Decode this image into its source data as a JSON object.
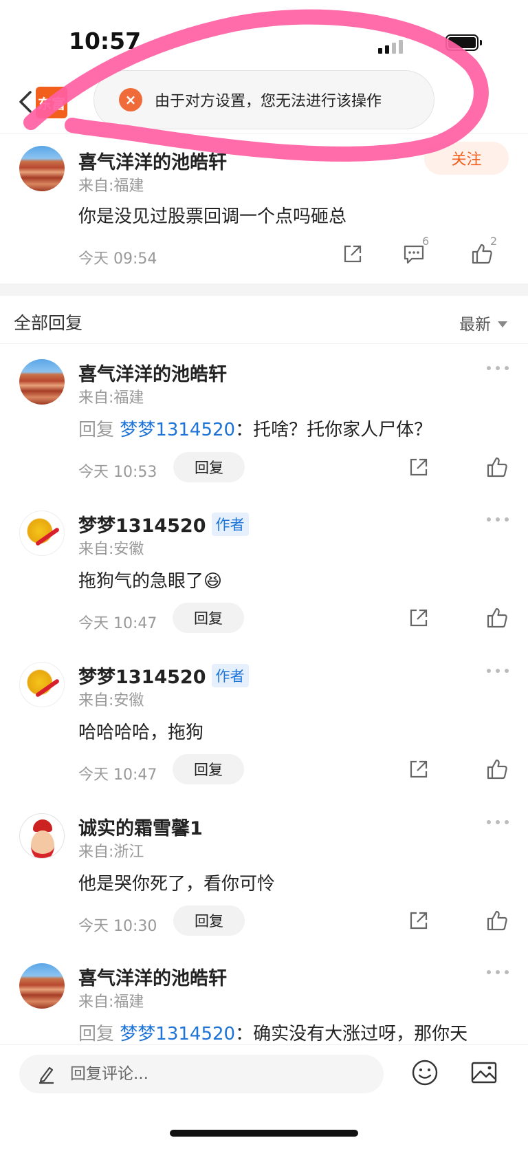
{
  "status_bar": {
    "time": "10:57"
  },
  "nav": {
    "app_logo_text": "东富"
  },
  "toast": {
    "icon": "close-icon",
    "text": "由于对方设置，您无法进行该操作"
  },
  "post": {
    "name": "喜气洋洋的池皓轩",
    "from": "来自:福建",
    "follow_label": "关注",
    "content": "你是没见过股票回调一个点吗砸总",
    "time": "今天 09:54",
    "comment_count": "6",
    "like_count": "2"
  },
  "section": {
    "title": "全部回复",
    "sort_label": "最新"
  },
  "replies": [
    {
      "name": "喜气洋洋的池皓轩",
      "badge": "",
      "from": "来自:福建",
      "prefix": "回复",
      "target": "梦梦1314520",
      "separator": "：",
      "text": "托啥？托你家人尸体？",
      "time": "今天 10:53",
      "reply_label": "回复"
    },
    {
      "name": "梦梦1314520",
      "badge": "作者",
      "from": "来自:安徽",
      "prefix": "",
      "target": "",
      "separator": "",
      "text": "拖狗气的急眼了😆",
      "time": "今天 10:47",
      "reply_label": "回复"
    },
    {
      "name": "梦梦1314520",
      "badge": "作者",
      "from": "来自:安徽",
      "prefix": "",
      "target": "",
      "separator": "",
      "text": "哈哈哈哈，拖狗",
      "time": "今天 10:47",
      "reply_label": "回复"
    },
    {
      "name": "诚实的霜雪馨1",
      "badge": "",
      "from": "来自:浙江",
      "prefix": "",
      "target": "",
      "separator": "",
      "text": "他是哭你死了，看你可怜",
      "time": "今天 10:30",
      "reply_label": "回复"
    },
    {
      "name": "喜气洋洋的池皓轩",
      "badge": "",
      "from": "来自:福建",
      "prefix": "回复",
      "target": "梦梦1314520",
      "separator": "：",
      "text": "确实没有大涨过呀，那你天",
      "time": "",
      "reply_label": ""
    }
  ],
  "bottom_bar": {
    "input_placeholder": "回复评论..."
  },
  "colors": {
    "accent": "#f25f1d",
    "link": "#1d73d6",
    "annotation": "#ff5fa2"
  }
}
